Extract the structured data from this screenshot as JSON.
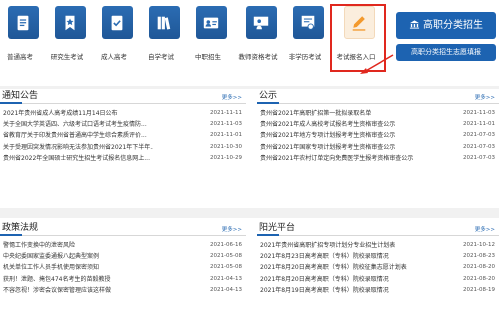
{
  "icons": [
    {
      "label": "普通高考",
      "icon": "document-icon"
    },
    {
      "label": "研究生考试",
      "icon": "star-bookmark-icon"
    },
    {
      "label": "成人高考",
      "icon": "checked-document-icon"
    },
    {
      "label": "自学考试",
      "icon": "books-icon"
    },
    {
      "label": "中职招生",
      "icon": "person-card-icon"
    },
    {
      "label": "教师资格考试",
      "icon": "teacher-icon"
    },
    {
      "label": "非学历考试",
      "icon": "certificate-icon"
    },
    {
      "label": "考试报名入口",
      "icon": "pencil-icon"
    }
  ],
  "buttons": {
    "gaozhi": "高职分类招生",
    "gaozhi_volunteer": "高职分类招生志愿填报"
  },
  "colors": {
    "primary": "#1d63b1",
    "highlight": "#e0281e",
    "accent_orange": "#f39a2e"
  },
  "notice": {
    "title": "通知公告",
    "more": "更多>>",
    "items": [
      {
        "text": "2021年贵州省成人高考成绩11月14日公布",
        "date": "2021-11-11"
      },
      {
        "text": "关于全国大学英语四、六级考试口语考试考生疫情防...",
        "date": "2021-11-03"
      },
      {
        "text": "省教育厅关于印发贵州省普通高中学生综合素质评价...",
        "date": "2021-11-01"
      },
      {
        "text": "关于受理因突发情况影响无法参加贵州省2021年下半年...",
        "date": "2021-10-30"
      },
      {
        "text": "贵州省2022年全国硕士研究生招生考试报名信息网上...",
        "date": "2021-10-29"
      }
    ]
  },
  "gongshi": {
    "title": "公示",
    "more": "更多>>",
    "items": [
      {
        "text": "贵州省2021年高职扩招第一批拟录取名单",
        "date": "2021-11-03"
      },
      {
        "text": "贵州省2021年成人高校考试报名考生资格审查公示",
        "date": "2021-11-01"
      },
      {
        "text": "贵州省2021年地方专项计划报考考生资格审查公示",
        "date": "2021-07-03"
      },
      {
        "text": "贵州省2021年国家专项计划报考考生资格审查公示",
        "date": "2021-07-03"
      },
      {
        "text": "贵州省2021年农村订单定向免费医学生报考资格审查公示",
        "date": "2021-07-03"
      }
    ]
  },
  "policy": {
    "title": "政策法规",
    "more": "更多>>",
    "items": [
      {
        "text": "警惕工作变换中的泄密风险",
        "date": "2021-06-16"
      },
      {
        "text": "中央纪委国家监委通报八起典型案例",
        "date": "2021-05-08"
      },
      {
        "text": "机关单位工作人员手机使用保密须知",
        "date": "2021-05-08"
      },
      {
        "text": "获刑！泄题、掩包474名考生的苗毅教授",
        "date": "2021-04-13"
      },
      {
        "text": "不容忽视！涉密会议保密管理应该这样做",
        "date": "2021-04-13"
      }
    ]
  },
  "sunshine": {
    "title": "阳光平台",
    "more": "更多>>",
    "items": [
      {
        "text": "2021年贵州省高职扩招专项计划分专业招生计划表",
        "date": "2021-10-12"
      },
      {
        "text": "2021年8月23日高考高职（专科）院校录取情况",
        "date": "2021-08-23"
      },
      {
        "text": "2021年8月20日高考高职（专科）院校征集志愿计划表",
        "date": "2021-08-20"
      },
      {
        "text": "2021年8月20日高考高职（专科）院校录取情况",
        "date": "2021-08-20"
      },
      {
        "text": "2021年8月19日高考高职（专科）院校录取情况",
        "date": "2021-08-19"
      }
    ]
  }
}
